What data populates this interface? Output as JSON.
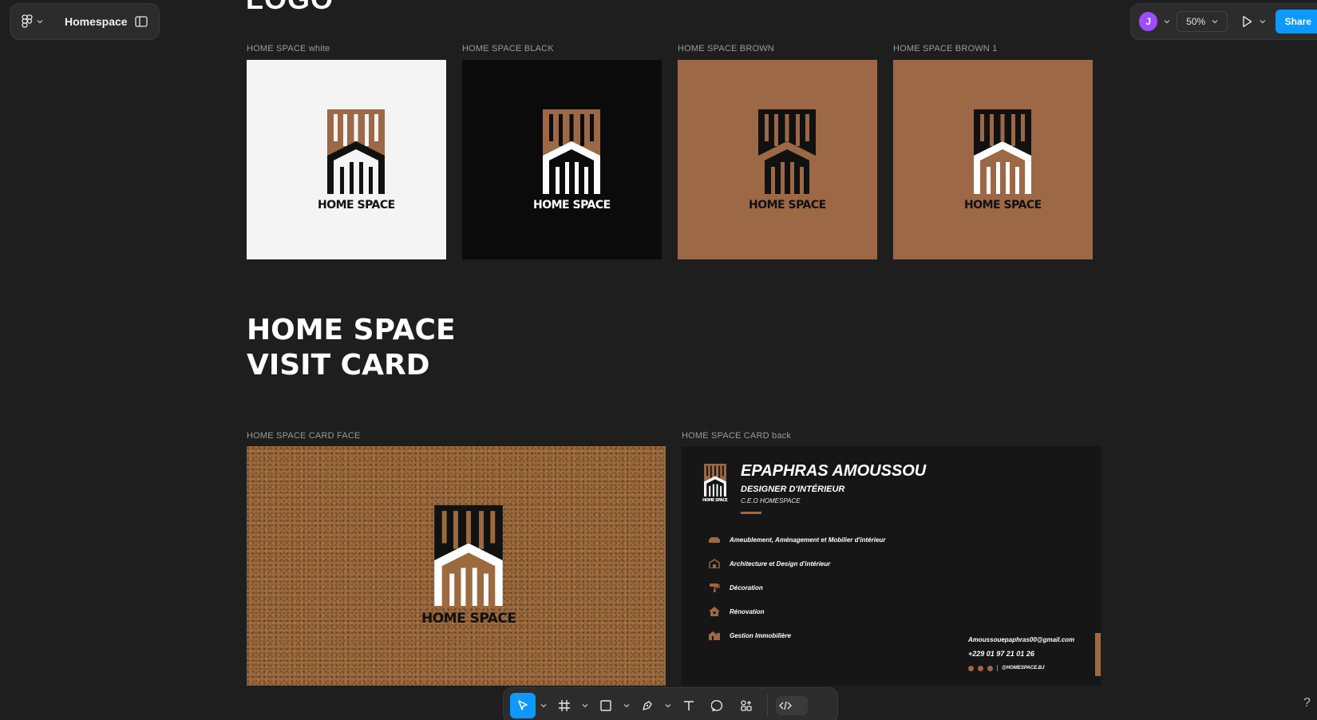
{
  "file": {
    "name": "Homespace"
  },
  "header": {
    "avatar_initial": "J",
    "zoom": "50%",
    "share_label": "Share"
  },
  "canvas": {
    "top_title": "LOGO",
    "logo_frames": [
      {
        "label": "HOME SPACE  white",
        "bg": "#f4f4f4"
      },
      {
        "label": "HOME SPACE  BLACK",
        "bg": "#0b0b0b"
      },
      {
        "label": "HOME SPACE  BROWN",
        "bg": "#9c6846"
      },
      {
        "label": "HOME SPACE  BROWN 1",
        "bg": "#9c6846"
      }
    ],
    "logo_text": "HOME SPACE",
    "section_title_line1": "HOME SPACE",
    "section_title_line2": "VISIT CARD",
    "card_face_label": "HOME SPACE CARD FACE",
    "card_back_label": "HOME SPACE CARD back"
  },
  "card_back": {
    "logo_text": "HOME SPACE",
    "name": "EPAPHRAS AMOUSSOU",
    "role": "DESIGNER D'INTÉRIEUR",
    "ceo": "C.E.O HOMESPACE",
    "services": [
      {
        "label": "Ameublement, Aménagement et Mobilier d'intérieur",
        "icon": "sofa-icon"
      },
      {
        "label": "Architecture et Design d'intérieur",
        "icon": "building-icon"
      },
      {
        "label": "Décoration",
        "icon": "paint-roller-icon"
      },
      {
        "label": "Rénovation",
        "icon": "house-icon"
      },
      {
        "label": "Gestion Immobilière",
        "icon": "real-estate-icon"
      }
    ],
    "email": "Amoussouepaphras00@gmail.com",
    "phone": "+229 01 97 21 01 26",
    "social_handle": "@HOMESPACE.BJ"
  },
  "colors": {
    "accent": "#0d99ff",
    "brand_brown": "#9c6846",
    "avatar": "#9b4dff"
  }
}
